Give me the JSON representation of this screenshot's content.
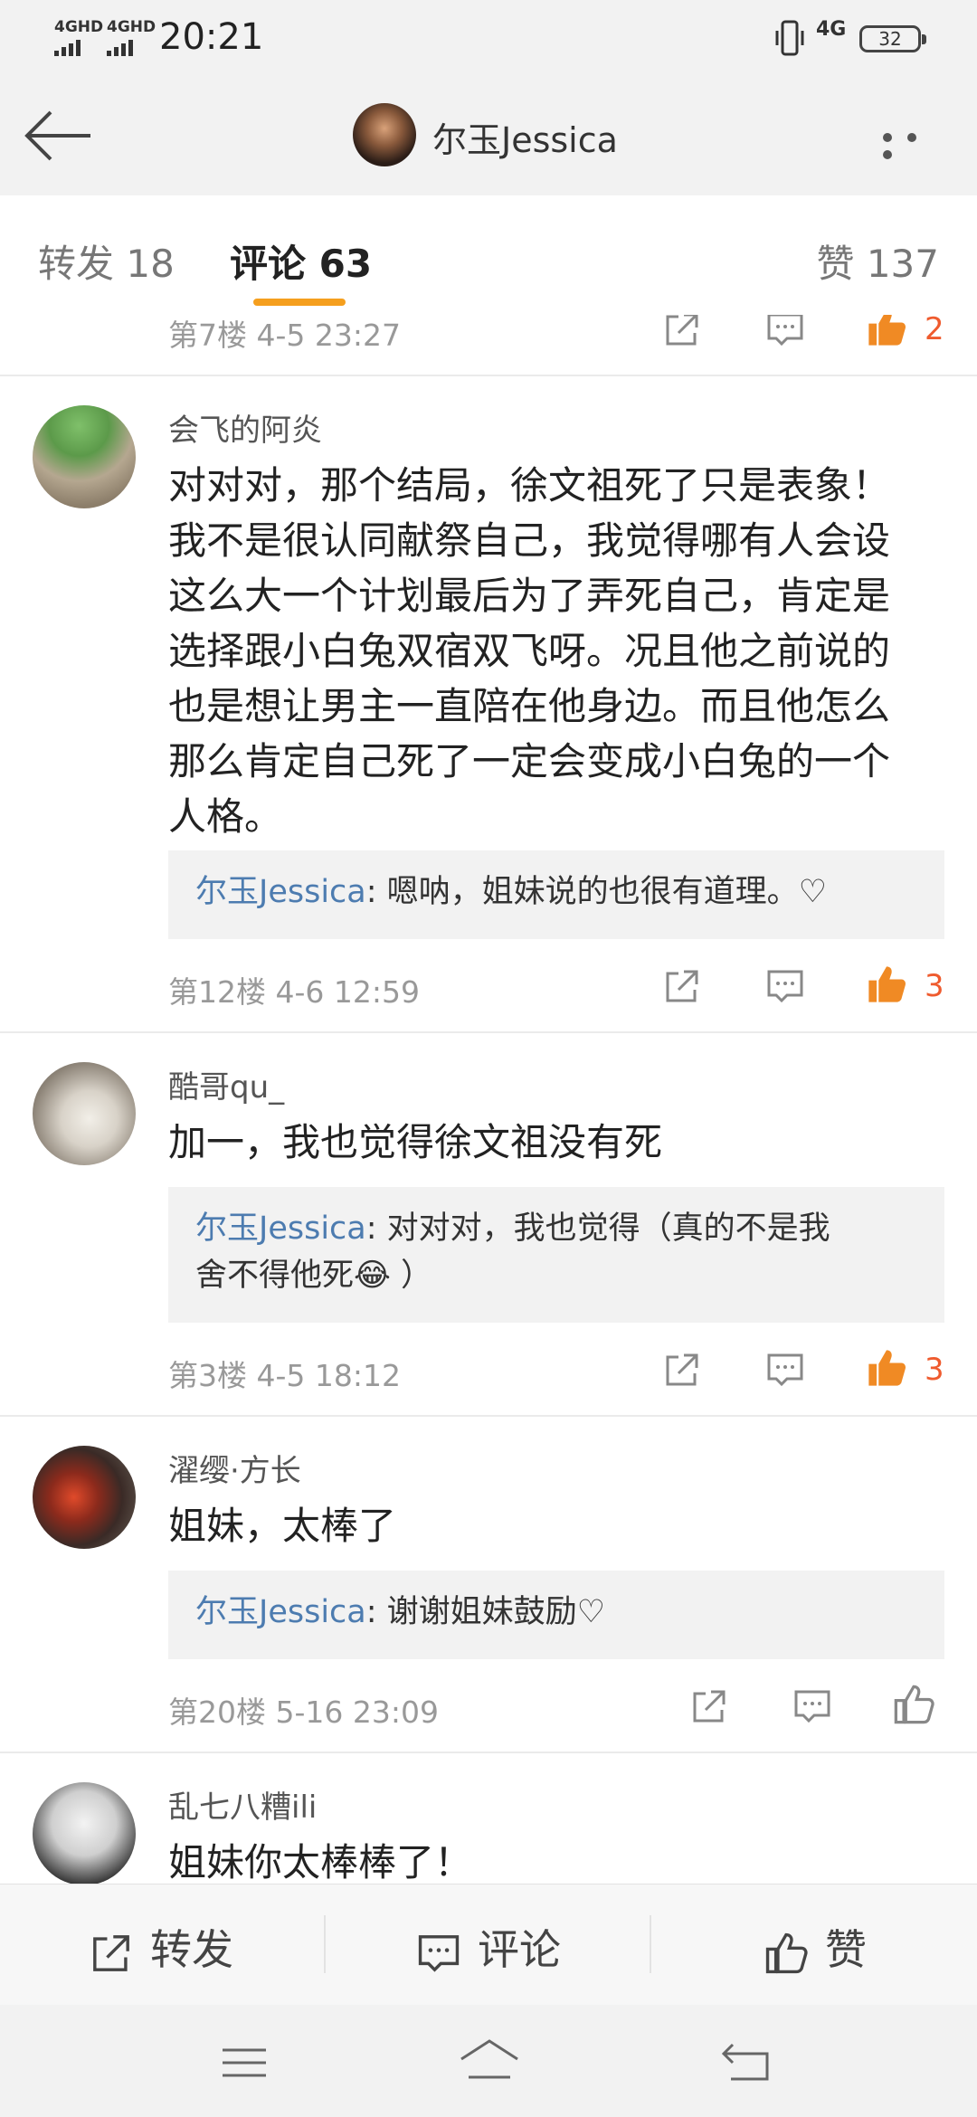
{
  "status_bar": {
    "signal1": "4GHD",
    "signal2": "4GHD",
    "time": "20:21",
    "network": "4G",
    "battery": "32"
  },
  "header": {
    "title": "尔玉Jessica",
    "back_icon": "back-arrow-icon",
    "more_icon": "more-dots-icon"
  },
  "tabs": {
    "repost": "转发 18",
    "comment": "评论 63",
    "like": "赞 137",
    "active": "comment",
    "accent": "#f59f1e"
  },
  "comments": [
    {
      "floor_meta": "第7楼 4-5 23:27",
      "likes": "2",
      "liked": true
    },
    {
      "username": "会飞的阿炎",
      "lines": [
        "对对对，那个结局，徐文祖死了只是表象！",
        "我不是很认同献祭自己，我觉得哪有人会设",
        "这么大一个计划最后为了弄死自己，肯定是",
        "选择跟小白兔双宿双飞呀。况且他之前说的",
        "也是想让男主一直陪在他身边。而且他怎么",
        "那么肯定自己死了一定会变成小白兔的一个",
        "人格。"
      ],
      "reply_name": "尔玉Jessica",
      "reply_text": ": 嗯呐，姐妹说的也很有道理。♡",
      "floor_meta": "第12楼 4-6 12:59",
      "likes": "3",
      "liked": true
    },
    {
      "username": "酷哥qu_",
      "lines": [
        "加一，我也觉得徐文祖没有死"
      ],
      "reply_name": "尔玉Jessica",
      "reply_text": ": 对对对，我也觉得（真的不是我",
      "reply_text2": "舍不得他死😂 ）",
      "floor_meta": "第3楼 4-5 18:12",
      "likes": "3",
      "liked": true
    },
    {
      "username": "濯缨·方长",
      "lines": [
        "姐妹，太棒了"
      ],
      "reply_name": "尔玉Jessica",
      "reply_text": ": 谢谢姐妹鼓励♡",
      "floor_meta": "第20楼 5-16 23:09",
      "likes": "",
      "liked": false
    },
    {
      "username": "乱七八糟ili",
      "lines": [
        "姐妹你太棒棒了！"
      ]
    }
  ],
  "bottom_bar": {
    "repost": "转发",
    "comment": "评论",
    "like": "赞"
  },
  "colors": {
    "like_active": "#ef5b2e",
    "reply_name": "#4d7cb0"
  }
}
